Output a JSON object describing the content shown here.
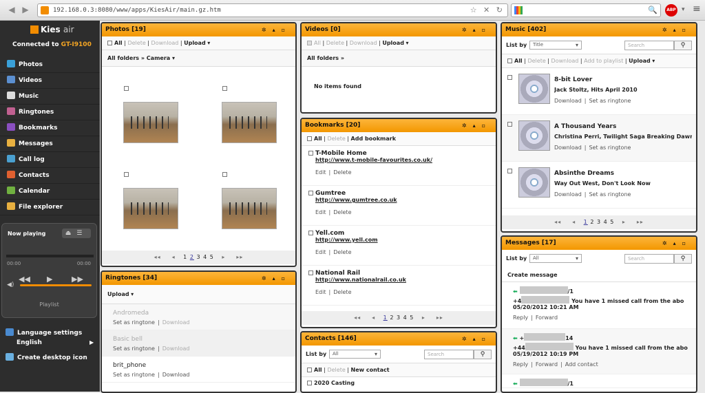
{
  "browser": {
    "url": "192.168.0.3:8080/www/apps/KiesAir/main.gz.htm",
    "back": "◀",
    "forward": "▶",
    "url_actions": "☆ ✕ ↻",
    "search_icon": "🔍",
    "abp": "ABP"
  },
  "sidebar": {
    "logo_text": "Kies",
    "logo_sub": "air",
    "connected_label": "Connected to",
    "device": "GT-I9100",
    "items": [
      {
        "label": "Photos",
        "icon": "photos-icon",
        "color": "#3aa0d8"
      },
      {
        "label": "Videos",
        "icon": "videos-icon",
        "color": "#5b8fd0"
      },
      {
        "label": "Music",
        "icon": "music-icon",
        "color": "#dddddd"
      },
      {
        "label": "Ringtones",
        "icon": "ringtones-icon",
        "color": "#c06090"
      },
      {
        "label": "Bookmarks",
        "icon": "bookmarks-icon",
        "color": "#8a4fc0"
      },
      {
        "label": "Messages",
        "icon": "messages-icon",
        "color": "#e8b040"
      },
      {
        "label": "Call log",
        "icon": "call-log-icon",
        "color": "#4aa0d0"
      },
      {
        "label": "Contacts",
        "icon": "contacts-icon",
        "color": "#e06030"
      },
      {
        "label": "Calendar",
        "icon": "calendar-icon",
        "color": "#70b040"
      },
      {
        "label": "File explorer",
        "icon": "folder-icon",
        "color": "#e8b040"
      }
    ],
    "player": {
      "title": "Now playing",
      "time_start": "00:00",
      "time_end": "00:00",
      "playlist": "Playlist"
    },
    "language_label": "Language settings",
    "language_value": "English",
    "desktop_label": "Create desktop icon"
  },
  "photos": {
    "title": "Photos [19]",
    "all": "All",
    "delete": "Delete",
    "download": "Download",
    "upload": "Upload",
    "folders": "All folders",
    "folder": "Camera",
    "pages": [
      "1",
      "2",
      "3",
      "4",
      "5"
    ],
    "current_page": "2"
  },
  "ringtones": {
    "title": "Ringtones [34]",
    "upload": "Upload",
    "set_as_ringtone": "Set as ringtone",
    "download": "Download",
    "items": [
      "Andromeda",
      "Basic bell",
      "brit_phone"
    ]
  },
  "videos": {
    "title": "Videos [0]",
    "all": "All",
    "delete": "Delete",
    "download": "Download",
    "upload": "Upload",
    "folders": "All folders",
    "empty": "No items found"
  },
  "bookmarks": {
    "title": "Bookmarks [20]",
    "all": "All",
    "delete": "Delete",
    "add": "Add bookmark",
    "edit": "Edit",
    "delete_action": "Delete",
    "items": [
      {
        "title": "T-Mobile Home",
        "url": "http://www.t-mobile-favourites.co.uk/"
      },
      {
        "title": "Gumtree",
        "url": "http://www.gumtree.co.uk"
      },
      {
        "title": "Yell.com",
        "url": "http://www.yell.com"
      },
      {
        "title": "National Rail",
        "url": "http://www.nationalrail.co.uk"
      }
    ],
    "pages": [
      "1",
      "2",
      "3",
      "4",
      "5"
    ]
  },
  "contacts": {
    "title": "Contacts [146]",
    "list_by": "List by",
    "list_value": "All",
    "search": "Search",
    "all": "All",
    "delete": "Delete",
    "new": "New contact",
    "first": "2020 Casting"
  },
  "music": {
    "title": "Music [402]",
    "list_by": "List by",
    "list_value": "Title",
    "search": "Search",
    "all": "All",
    "delete": "Delete",
    "download": "Download",
    "add_playlist": "Add to playlist",
    "upload": "Upload",
    "set_as_ringtone": "Set as ringtone",
    "tracks": [
      {
        "title": "8-bit Lover",
        "artist": "Jack Stoltz, Hits April 2010"
      },
      {
        "title": "A Thousand Years",
        "artist": "Christina Perri, Twilight Saga Breaking Dawr..."
      },
      {
        "title": "Absinthe Dreams",
        "artist": "Way Out West, Don't Look Now"
      }
    ],
    "pages": [
      "1",
      "2",
      "3",
      "4",
      "5"
    ]
  },
  "messages": {
    "title": "Messages [17]",
    "list_by": "List by",
    "list_value": "All",
    "search": "Search",
    "create": "Create message",
    "reply": "Reply",
    "forward": "Forward",
    "add_contact": "Add contact",
    "items": [
      {
        "sender_tail": "/1",
        "number_head": "+4",
        "text": "You have 1 missed call from the abo",
        "date": "05/20/2012 10:21 AM"
      },
      {
        "sender_tail": "14",
        "number_head": "+44",
        "text": "You have 1 missed call from the abo",
        "date": "05/19/2012 10:19 PM"
      },
      {
        "sender_tail": "/1"
      }
    ]
  }
}
